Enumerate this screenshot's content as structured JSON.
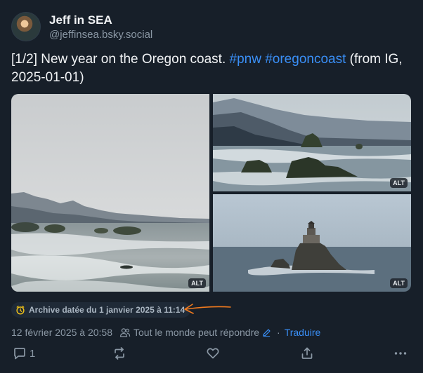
{
  "author": {
    "display_name": "Jeff in SEA",
    "handle": "@jeffinsea.bsky.social"
  },
  "post": {
    "text_prefix": "[1/2] New year on the Oregon coast. ",
    "hashtag_1": "#pnw",
    "hashtag_2": "#oregoncoast",
    "text_suffix": " (from IG, 2025-01-01)"
  },
  "images": [
    {
      "alt_label": "ALT"
    },
    {
      "alt_label": "ALT"
    },
    {
      "alt_label": "ALT"
    }
  ],
  "archive_badge": {
    "label": "Archive datée du 1 janvier 2025 à 11:14"
  },
  "meta": {
    "timestamp": "12 février 2025 à 20:58",
    "reply_setting": "Tout le monde peut répondre",
    "separator": "·",
    "translate_label": "Traduire"
  },
  "actions": {
    "reply_count": "1"
  },
  "colors": {
    "background": "#171f29",
    "link": "#3a8ff7",
    "muted": "#8b98a5",
    "annotation_arrow": "#f07a1e"
  }
}
